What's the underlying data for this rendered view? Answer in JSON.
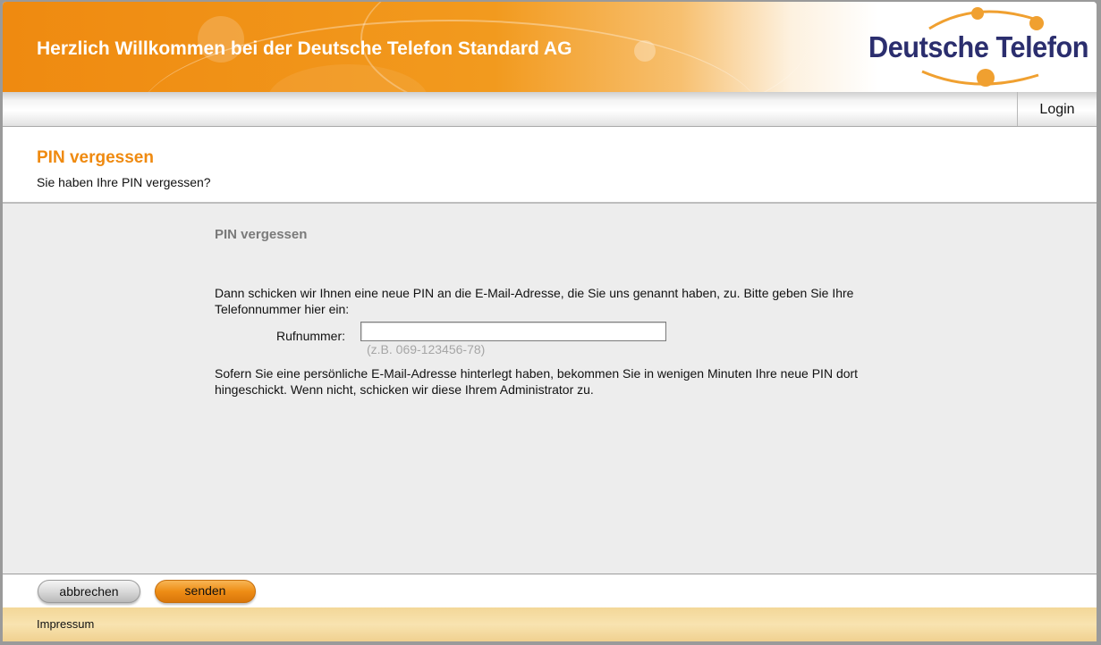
{
  "header": {
    "title": "Herzlich Willkommen bei der Deutsche Telefon Standard AG",
    "logo_text": "Deutsche Telefon"
  },
  "nav": {
    "login_label": "Login"
  },
  "page": {
    "title": "PIN vergessen",
    "subtitle": "Sie haben Ihre PIN vergessen?"
  },
  "form": {
    "section_title": "PIN vergessen",
    "intro": "Dann schicken wir Ihnen eine neue PIN an die E-Mail-Adresse, die Sie uns genannt haben, zu. Bitte geben Sie Ihre Telefonnummer hier ein:",
    "phone_label": "Rufnummer:",
    "phone_value": "",
    "phone_hint": "(z.B. 069-123456-78)",
    "outro": "Sofern Sie eine persönliche E-Mail-Adresse hinterlegt haben, bekommen Sie in wenigen Minuten Ihre neue PIN dort hingeschickt. Wenn nicht, schicken wir diese Ihrem Administrator zu."
  },
  "buttons": {
    "cancel_label": "abbrechen",
    "send_label": "senden"
  },
  "footer": {
    "impressum_label": "Impressum"
  },
  "colors": {
    "brand_orange": "#ef8a10",
    "logo_navy": "#2b2e6e",
    "footer_gold": "#f3d798"
  }
}
